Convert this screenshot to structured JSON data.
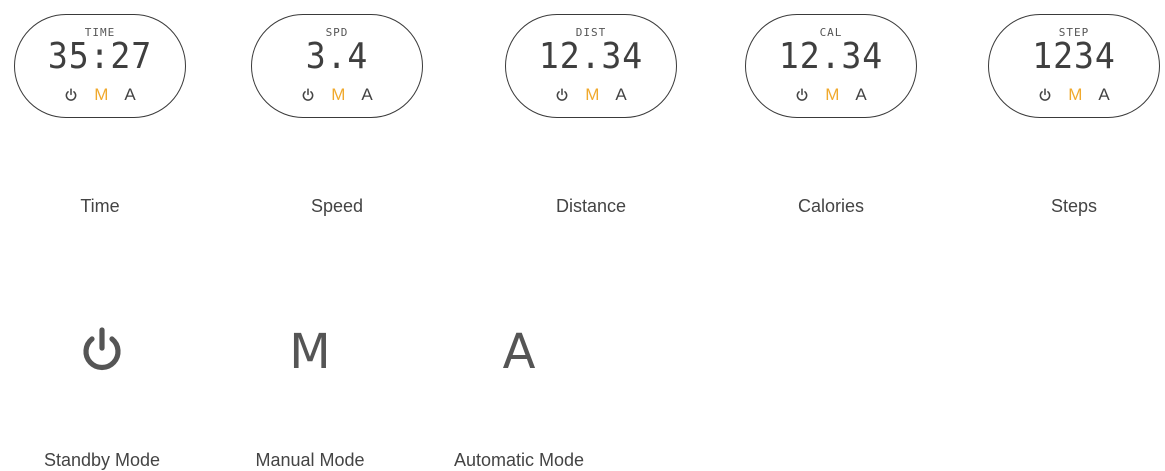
{
  "displays": [
    {
      "label": "TIME",
      "value": "35:27",
      "caption": "Time"
    },
    {
      "label": "SPD",
      "value": "3.4",
      "caption": "Speed"
    },
    {
      "label": "DIST",
      "value": "12.34",
      "caption": "Distance"
    },
    {
      "label": "CAL",
      "value": "12.34",
      "caption": "Calories"
    },
    {
      "label": "STEP",
      "value": "1234",
      "caption": "Steps"
    }
  ],
  "display_modes": {
    "power_icon": "power-icon",
    "manual": "M",
    "automatic": "A",
    "active": "M"
  },
  "modes": [
    {
      "icon": "power-icon",
      "caption": "Standby Mode"
    },
    {
      "symbol": "M",
      "caption": "Manual Mode"
    },
    {
      "symbol": "A",
      "caption": "Automatic Mode"
    }
  ],
  "colors": {
    "active_mode": "#f0a92d",
    "text": "#444444",
    "outline": "#3a3a3a"
  }
}
